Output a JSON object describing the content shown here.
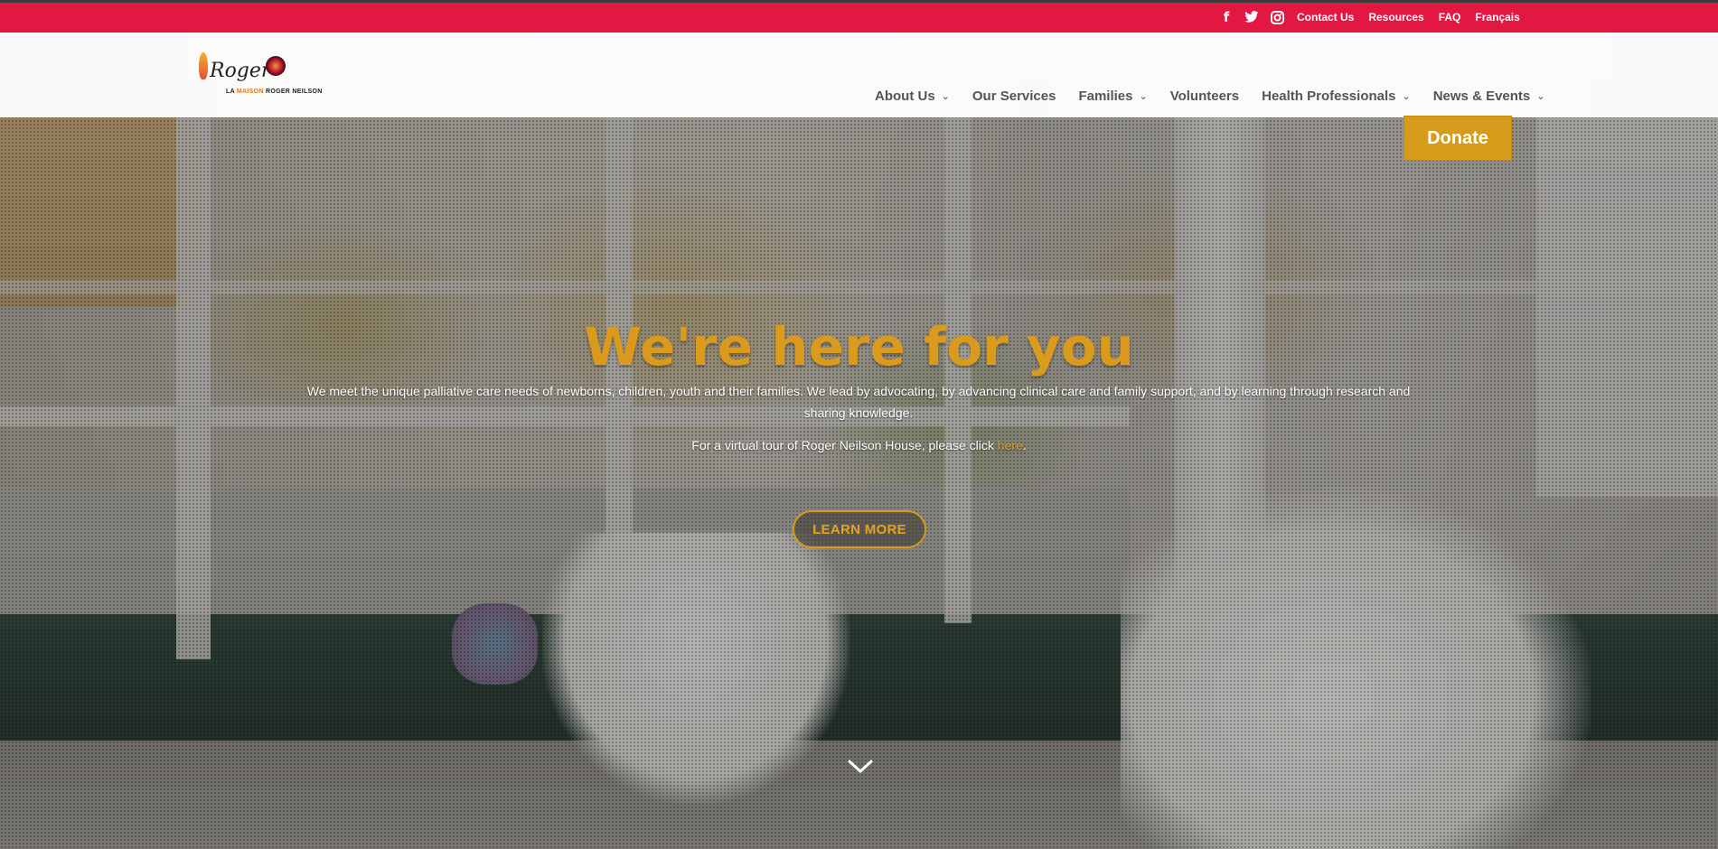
{
  "topbar": {
    "social": [
      {
        "name": "facebook-icon",
        "glyph": "f"
      },
      {
        "name": "twitter-icon"
      },
      {
        "name": "instagram-icon"
      }
    ],
    "links": [
      "Contact Us",
      "Resources",
      "FAQ",
      "Français"
    ]
  },
  "logo": {
    "wordmark": "Roger",
    "tagline_prefix": "LA ",
    "tagline_highlight": "MAISON",
    "tagline_suffix": " ROGER NEILSON"
  },
  "nav": {
    "items": [
      {
        "label": "About Us",
        "has_dropdown": true
      },
      {
        "label": "Our Services",
        "has_dropdown": false
      },
      {
        "label": "Families",
        "has_dropdown": true
      },
      {
        "label": "Volunteers",
        "has_dropdown": false
      },
      {
        "label": "Health Professionals",
        "has_dropdown": true
      },
      {
        "label": "News & Events",
        "has_dropdown": true
      }
    ],
    "chevron": "⌄"
  },
  "donate": {
    "label": "Donate"
  },
  "hero": {
    "title": "We're here for you",
    "description": "We meet the unique palliative care needs of newborns, children, youth and their families. We lead by advocating, by advancing clinical care and family support, and by learning through research and sharing knowledge.",
    "tour_prefix": "For a virtual tour of Roger Neilson House, please click ",
    "tour_link": "here",
    "tour_suffix": ".",
    "cta": "LEARN MORE"
  },
  "colors": {
    "brand_red": "#e21742",
    "accent_gold": "#d69b1b",
    "nav_text": "#555555"
  }
}
